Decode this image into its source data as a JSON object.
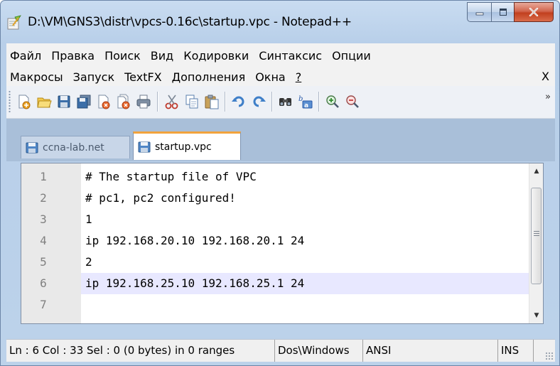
{
  "window": {
    "title": "D:\\VM\\GNS3\\distr\\vpcs-0.16c\\startup.vpc - Notepad++",
    "app_icon": "notepad-chameleon-icon"
  },
  "caption_buttons": {
    "minimize": "minimize-icon",
    "maximize": "maximize-icon",
    "close": "close-icon"
  },
  "menu": {
    "row1": [
      "Файл",
      "Правка",
      "Поиск",
      "Вид",
      "Кодировки",
      "Синтаксис",
      "Опции"
    ],
    "row2": [
      "Макросы",
      "Запуск",
      "TextFX",
      "Дополнения",
      "Окна",
      "?"
    ],
    "close_label": "X"
  },
  "toolbar": {
    "icons": [
      "new-file-icon",
      "open-file-icon",
      "save-icon",
      "save-all-icon",
      "close-file-icon",
      "close-all-icon",
      "print-icon",
      "cut-icon",
      "copy-icon",
      "paste-icon",
      "undo-icon",
      "redo-icon",
      "find-icon",
      "replace-icon",
      "zoom-in-icon",
      "zoom-out-icon"
    ],
    "overflow": "»"
  },
  "tabs": [
    {
      "label": "ccna-lab.net",
      "active": false
    },
    {
      "label": "startup.vpc",
      "active": true
    }
  ],
  "editor": {
    "lines": [
      {
        "num": "1",
        "text": "# The startup file of VPC"
      },
      {
        "num": "2",
        "text": "# pc1, pc2 configured!"
      },
      {
        "num": "3",
        "text": "1"
      },
      {
        "num": "4",
        "text": "ip 192.168.20.10 192.168.20.1 24"
      },
      {
        "num": "5",
        "text": "2"
      },
      {
        "num": "6",
        "text": "ip 192.168.25.10 192.168.25.1 24"
      },
      {
        "num": "7",
        "text": ""
      }
    ],
    "current_line": 6
  },
  "status": {
    "position": "Ln : 6    Col : 33    Sel : 0 (0 bytes) in 0 ranges",
    "eol": "Dos\\Windows",
    "encoding": "ANSI",
    "mode": "INS"
  },
  "colors": {
    "current_line_bg": "#e8e8ff",
    "line_number": "#808080",
    "tab_accent": "#f2a33c",
    "titlebar": "#c9dcf1"
  }
}
